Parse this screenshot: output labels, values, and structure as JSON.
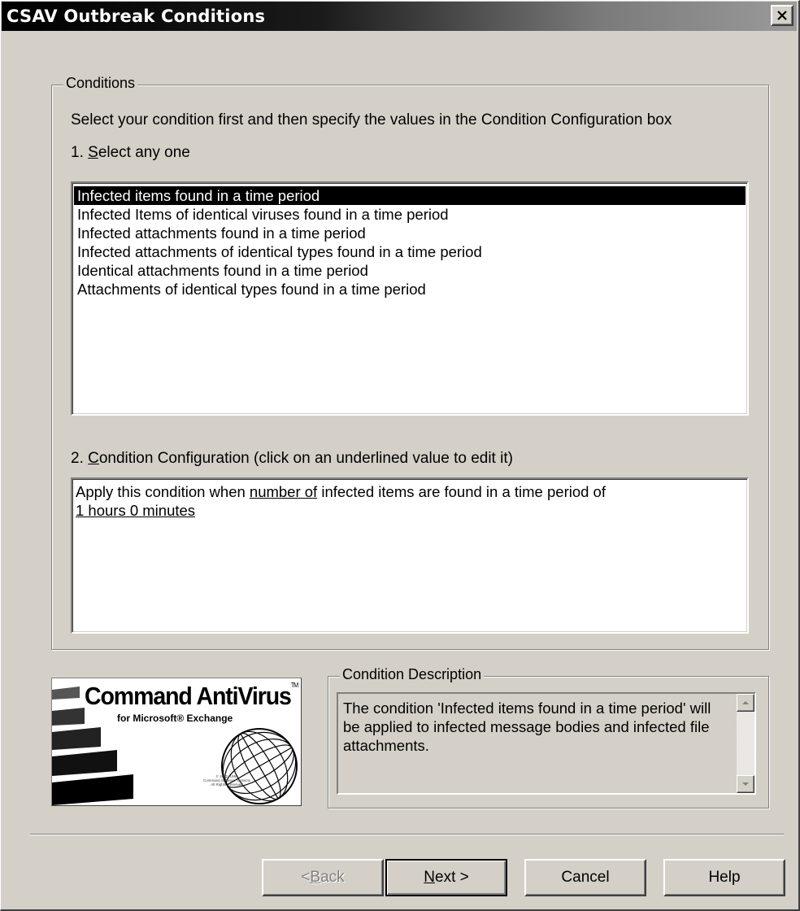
{
  "window": {
    "title": "CSAV Outbreak Conditions"
  },
  "conditions": {
    "group_label": "Conditions",
    "instruction": "Select your condition first and then specify the values in the Condition Configuration box",
    "select_label_prefix": "1. ",
    "select_label_accel": "S",
    "select_label_rest": "elect any one",
    "items": [
      "Infected items found in a time period",
      "Infected Items of identical viruses found in a time period",
      "Infected attachments found in a time period",
      "Infected attachments of identical types found in a time period",
      "Identical attachments found in a time period",
      "Attachments of identical types found in a time period"
    ],
    "selected_index": 0,
    "config_label_prefix": "2. ",
    "config_label_accel": "C",
    "config_label_rest": "ondition Configuration (click on an underlined value to edit it)",
    "config_text_1": "Apply this condition when ",
    "config_link_1": "number of",
    "config_text_2": "  infected items are found in a time period of",
    "config_link_2": "1 hours 0 minutes"
  },
  "logo": {
    "title": "Command AntiVirus",
    "tm": "TM",
    "subtitle": "for Microsoft® Exchange",
    "copyright": "© 1992, 1999\nCommand Software Systems\nAll Rights Reserved"
  },
  "description": {
    "group_label": "Condition Description",
    "text": "The condition 'Infected items found in a time period' will be applied to infected message bodies and infected file attachments."
  },
  "buttons": {
    "back_prefix": "< ",
    "back_accel": "B",
    "back_rest": "ack",
    "next_accel": "N",
    "next_rest": "ext >",
    "cancel": "Cancel",
    "help": "Help"
  }
}
